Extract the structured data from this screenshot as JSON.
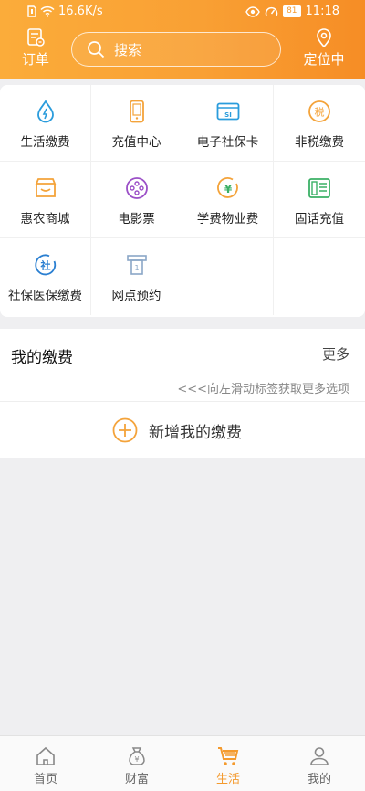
{
  "status_bar": {
    "network_speed": "16.6K/s",
    "battery": "81",
    "time": "11:18"
  },
  "header": {
    "order_label": "订单",
    "search_placeholder": "搜索",
    "location_label": "定位中"
  },
  "services": [
    {
      "label": "生活缴费",
      "icon": "water-drop-icon",
      "color": "#2a9cdc"
    },
    {
      "label": "充值中心",
      "icon": "phone-icon",
      "color": "#f4a33a"
    },
    {
      "label": "电子社保卡",
      "icon": "social-security-card-icon",
      "color": "#2a9cdc"
    },
    {
      "label": "非税缴费",
      "icon": "tax-icon",
      "color": "#f4a33a"
    },
    {
      "label": "惠农商城",
      "icon": "store-icon",
      "color": "#f4a33a"
    },
    {
      "label": "电影票",
      "icon": "film-reel-icon",
      "color": "#9b4fc7"
    },
    {
      "label": "学费物业费",
      "icon": "yuan-coin-icon",
      "color": "#f4a33a"
    },
    {
      "label": "固话充值",
      "icon": "landline-phone-icon",
      "color": "#3bb066"
    },
    {
      "label": "社保医保缴费",
      "icon": "social-insurance-icon",
      "color": "#2a7fd1"
    },
    {
      "label": "网点预约",
      "icon": "bank-branch-icon",
      "color": "#8aa7c7"
    }
  ],
  "my_payments": {
    "title": "我的缴费",
    "more": "更多",
    "hint": "<<<向左滑动标签获取更多选项",
    "add_label": "新增我的缴费"
  },
  "tabs": [
    {
      "label": "首页",
      "icon": "home-icon",
      "active": false
    },
    {
      "label": "财富",
      "icon": "money-bag-icon",
      "active": false
    },
    {
      "label": "生活",
      "icon": "shopping-cart-icon",
      "active": true
    },
    {
      "label": "我的",
      "icon": "user-icon",
      "active": false
    }
  ],
  "colors": {
    "accent": "#f49a2d",
    "header_gradient_start": "#fbac3a",
    "header_gradient_end": "#f68d25"
  }
}
